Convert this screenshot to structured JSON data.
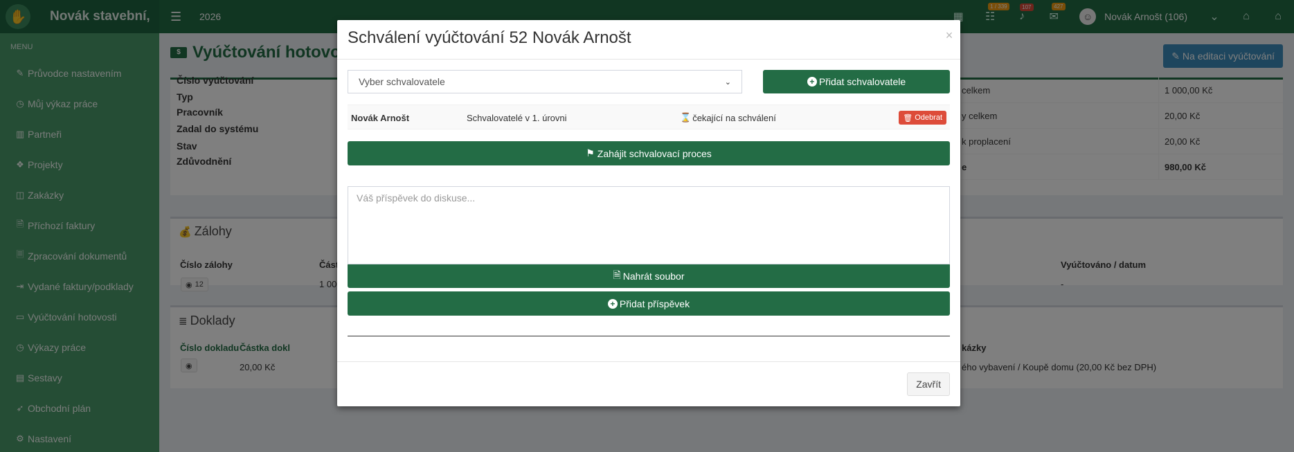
{
  "navbar": {
    "brand": "Novák stavební,",
    "year": "2026",
    "badges": {
      "tasks": "1 / 339",
      "notifications": "107",
      "messages": "427"
    },
    "user": "Novák Arnošt (106)"
  },
  "sidebar": {
    "header": "MENU",
    "items": [
      {
        "label": "Průvodce nastavením",
        "icon": "pencil-icon"
      },
      {
        "label": "Můj výkaz práce",
        "icon": "clock-icon"
      },
      {
        "label": "Partneři",
        "icon": "building-icon"
      },
      {
        "label": "Projekty",
        "icon": "cubes-icon"
      },
      {
        "label": "Zakázky",
        "icon": "cube-icon"
      },
      {
        "label": "Příchozí faktury",
        "icon": "file-icon"
      },
      {
        "label": "Zpracování dokumentů",
        "icon": "file-text-icon"
      },
      {
        "label": "Vydané faktury/podklady",
        "icon": "file-export-icon"
      },
      {
        "label": "Vyúčtování hotovosti",
        "icon": "money-icon"
      },
      {
        "label": "Výkazy práce",
        "icon": "clock-icon"
      },
      {
        "label": "Sestavy",
        "icon": "chart-icon"
      },
      {
        "label": "Obchodní plán",
        "icon": "rocket-icon"
      },
      {
        "label": "Nastavení",
        "icon": "cogs-icon"
      }
    ]
  },
  "page": {
    "title": "Vyúčtování hotovo",
    "edit_button": "Na editaci vyúčtování",
    "detail_labels": [
      "Číslo vyúčtování",
      "Typ",
      "Pracovník",
      "Zadal do systému",
      "Stav",
      "Zdůvodnění"
    ],
    "summary": [
      {
        "label": "celkem",
        "value": "1 000,00 Kč",
        "bold": false
      },
      {
        "label": "y celkem",
        "value": "20,00 Kč",
        "bold": false
      },
      {
        "label": "k proplacení",
        "value": "20,00 Kč",
        "bold": false
      },
      {
        "label": "e",
        "value": "980,00 Kč",
        "bold": true
      }
    ],
    "advances": {
      "title": "Zálohy",
      "col_number": "Číslo zálohy",
      "col_amount": "Část",
      "col_settled": "Vyúčtováno / datum",
      "row_id": "12",
      "row_amount": "1 000",
      "row_settled": "-"
    },
    "documents": {
      "title": "Doklady",
      "col_number": "Číslo dokladu",
      "col_amount": "Částka dokl",
      "col_order": "kázky",
      "row_amount": "20,00 Kč",
      "row_order": "ého vybavení / Koupě domu (20,00 Kč bez DPH)"
    }
  },
  "modal": {
    "title": "Schválení vyúčtování 52 Novák Arnošt",
    "close_glyph": "×",
    "select_placeholder": "Vyber schvalovatele",
    "add_approver": "Přidat schvalovatele",
    "approver": {
      "name": "Novák Arnošt",
      "level": "Schvalovatelé v 1. úrovni",
      "status": "čekající na schválení",
      "remove": "Odebrat"
    },
    "start_process": "Zahájit schvalovací proces",
    "comment_placeholder": "Váš příspěvek do diskuse...",
    "upload_file": "Nahrát soubor",
    "add_post": "Přidat příspěvek",
    "close_button": "Zavřít"
  }
}
